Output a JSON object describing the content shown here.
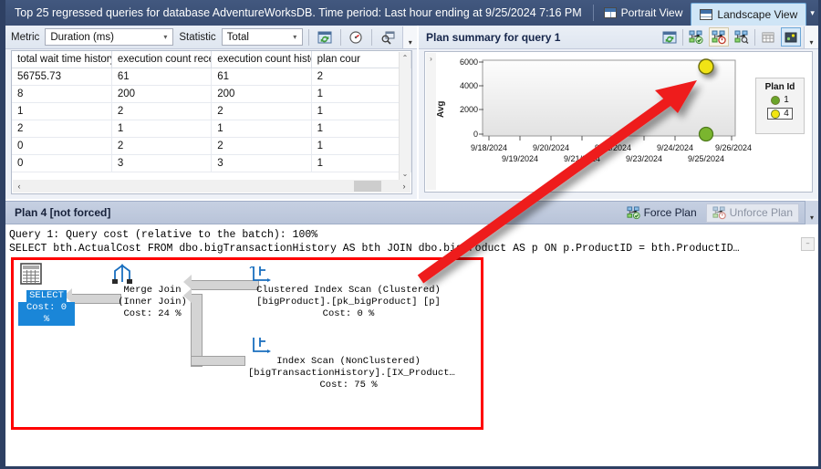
{
  "titlebar": {
    "title": "Top 25 regressed queries for database AdventureWorksDB. Time period: Last hour ending at 9/25/2024 7:16 PM",
    "tabs": [
      {
        "label": "Portrait View",
        "icon": "portrait-view-icon",
        "active": false
      },
      {
        "label": "Landscape View",
        "icon": "landscape-view-icon",
        "active": true
      }
    ],
    "overflow": "▾"
  },
  "left_toolbar": {
    "metric_label": "Metric",
    "metric_value": "Duration (ms)",
    "statistic_label": "Statistic",
    "statistic_value": "Total",
    "buttons": [
      {
        "name": "refresh-icon",
        "title": "Refresh"
      },
      {
        "name": "configure-icon",
        "title": "Configure"
      },
      {
        "name": "view-query-text-icon",
        "title": "View query text"
      }
    ],
    "overflow": "▾"
  },
  "grid": {
    "columns": [
      "total wait time history",
      "execution count recent",
      "execution count history",
      "plan cour"
    ],
    "rows": [
      [
        "56755.73",
        "61",
        "61",
        "2"
      ],
      [
        "8",
        "200",
        "200",
        "1"
      ],
      [
        "1",
        "2",
        "2",
        "1"
      ],
      [
        "2",
        "1",
        "1",
        "1"
      ],
      [
        "0",
        "2",
        "2",
        "1"
      ],
      [
        "0",
        "3",
        "3",
        "1"
      ]
    ],
    "scroll_up": "⌃",
    "scroll_down": "⌄",
    "scroll_left": "‹",
    "scroll_right": "›"
  },
  "right_panel": {
    "title": "Plan summary for query 1",
    "buttons": [
      {
        "name": "refresh-icon",
        "title": "Refresh",
        "state": "normal"
      },
      {
        "name": "force-plan-icon",
        "title": "Force Plan",
        "state": "normal"
      },
      {
        "name": "unforce-plan-icon",
        "title": "Unforce Plan",
        "state": "active"
      },
      {
        "name": "track-plan-icon",
        "title": "Track Plan",
        "state": "normal"
      },
      {
        "name": "grid-view-icon",
        "title": "Grid view",
        "state": "normal"
      },
      {
        "name": "chart-view-icon",
        "title": "Chart view",
        "state": "selected"
      }
    ],
    "collapse": "›",
    "overflow": "▾"
  },
  "chart_data": {
    "type": "scatter",
    "title": "",
    "xlabel": "",
    "ylabel": "Avg",
    "ylim": [
      0,
      6500
    ],
    "yticks": [
      0,
      2000,
      4000,
      6000
    ],
    "ytick_labels": [
      "0",
      "2000",
      "4000",
      "6000"
    ],
    "xticks": [
      "9/18/2024",
      "9/19/2024",
      "9/20/2024",
      "9/21/2024",
      "9/22/2024",
      "9/23/2024",
      "9/24/2024",
      "9/25/2024",
      "9/26/2024"
    ],
    "grid": false,
    "legend": {
      "title": "Plan Id",
      "position": "right",
      "entries": [
        {
          "label": "1",
          "color": "#6aa52a",
          "selected": false
        },
        {
          "label": "4",
          "color": "#f2e511",
          "selected": true
        }
      ]
    },
    "series": [
      {
        "name": "1",
        "color": "#7ab52f",
        "points": [
          {
            "x": "9/25/2024",
            "y": 0
          }
        ]
      },
      {
        "name": "4",
        "color": "#f0e312",
        "points": [
          {
            "x": "9/25/2024",
            "y": 5700
          }
        ]
      }
    ]
  },
  "plan_bar": {
    "label": "Plan 4 [not forced]",
    "force_plan": "Force Plan",
    "unforce_plan": "Unforce Plan",
    "unforce_disabled": true,
    "overflow": "▾"
  },
  "query_text": {
    "line1": "Query 1: Query cost (relative to the batch): 100%",
    "line2": "SELECT bth.ActualCost FROM dbo.bigTransactionHistory AS bth JOIN dbo.bigProduct AS p ON p.ProductID = bth.ProductID…",
    "scroll_glyph": "‒"
  },
  "plan_nodes": {
    "select": {
      "icon": "result-grid-icon",
      "label": "SELECT",
      "cost": "Cost: 0 %"
    },
    "merge_join": {
      "icon": "merge-join-icon",
      "line1": "Merge Join",
      "line2": "(Inner Join)",
      "cost": "Cost: 24 %"
    },
    "clustered_index_scan": {
      "icon": "index-scan-icon",
      "line1": "Clustered Index Scan (Clustered)",
      "line2": "[bigProduct].[pk_bigProduct] [p]",
      "cost": "Cost: 0 %"
    },
    "index_scan": {
      "icon": "index-scan-icon",
      "line1": "Index Scan (NonClustered)",
      "line2": "[bigTransactionHistory].[IX_Product…",
      "cost": "Cost: 75 %"
    }
  },
  "annotation": {
    "arrow_color": "#ee1c1c",
    "highlight_box_color": "#ff0000"
  }
}
